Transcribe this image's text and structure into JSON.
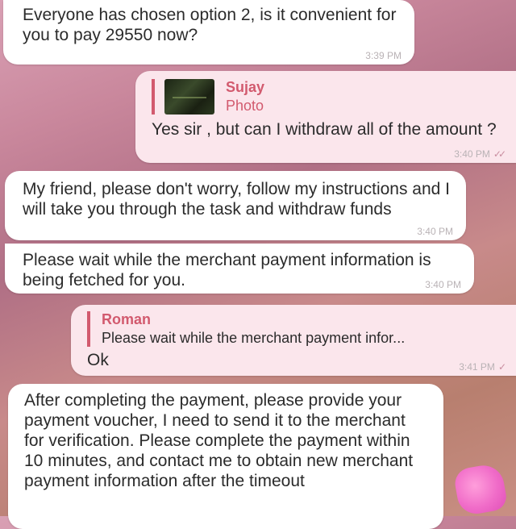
{
  "messages": [
    {
      "direction": "incoming",
      "text": "Everyone has chosen option 2, is it convenient for you to pay 29550 now?",
      "time": "3:39 PM"
    },
    {
      "direction": "outgoing",
      "reply": {
        "name": "Sujay",
        "subtitle": "Photo"
      },
      "text": "Yes sir , but can I withdraw all of the amount ?",
      "time": "3:40 PM",
      "status_icon": "double-check-icon"
    },
    {
      "direction": "incoming",
      "text": "My friend, please don't worry, follow my instructions and I will take you through the task and withdraw funds",
      "time": "3:40 PM"
    },
    {
      "direction": "incoming",
      "text": "Please wait while the merchant payment information is being fetched for you.",
      "time": "3:40 PM"
    },
    {
      "direction": "outgoing",
      "reply": {
        "name": "Roman",
        "subtitle": "Please wait while the merchant payment infor..."
      },
      "text": "Ok",
      "time": "3:41 PM",
      "status_icon": "single-check-icon"
    },
    {
      "direction": "incoming",
      "text": "After completing the payment, please provide your payment voucher, I need to send it to the merchant for verification. Please complete the payment within 10 minutes, and contact me to obtain new merchant payment information after the timeout",
      "time": ""
    }
  ],
  "colors": {
    "incoming_bubble": "#ffffff",
    "outgoing_bubble": "#fbe6ec",
    "reply_accent": "#d25a6e",
    "timestamp": "#b9b2b5"
  }
}
